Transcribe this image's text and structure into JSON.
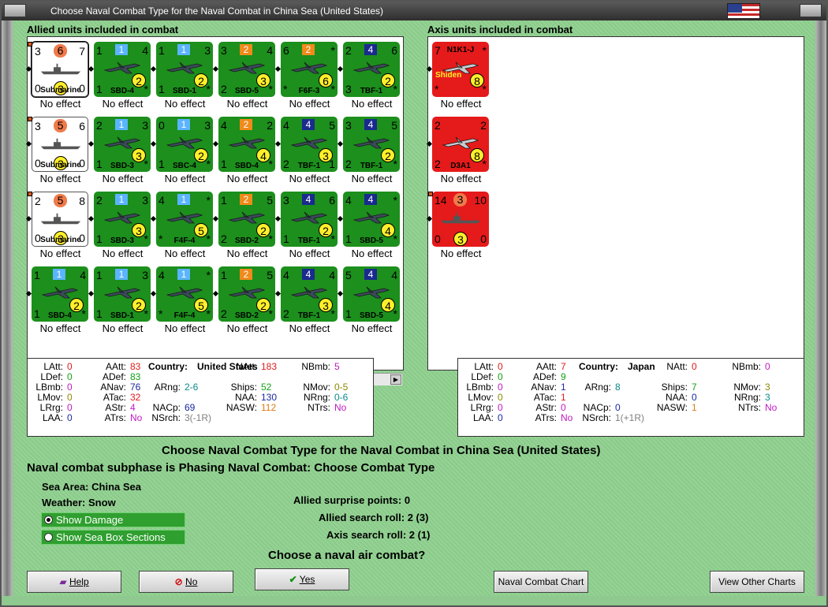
{
  "window": {
    "title": "Choose Naval Combat Type for the Naval Combat in China Sea (United States)"
  },
  "allied": {
    "header": "Allied units included in combat",
    "units": [
      {
        "type": "ship",
        "name": "Submarine",
        "tl": "3",
        "tr": "7",
        "bl": "0",
        "br": "0",
        "top": "6",
        "bottom": "3",
        "effect": "No effect",
        "selected": true
      },
      {
        "type": "air",
        "name": "SBD-4",
        "tl": "1",
        "tr": "4",
        "bl": "1",
        "br": "*",
        "top": "1",
        "topColor": "#5ab4ff",
        "bottom": "2",
        "effect": "No effect"
      },
      {
        "type": "air",
        "name": "SBD-1",
        "tl": "1",
        "tr": "3",
        "bl": "1",
        "br": "*",
        "top": "1",
        "topColor": "#5ab4ff",
        "bottom": "2",
        "effect": "No effect"
      },
      {
        "type": "air",
        "name": "SBD-5",
        "tl": "3",
        "tr": "4",
        "bl": "2",
        "br": "*",
        "top": "2",
        "topColor": "#f08a1a",
        "bottom": "3",
        "effect": "No effect"
      },
      {
        "type": "air",
        "name": "F6F-3",
        "tl": "6",
        "tr": "*",
        "bl": "*",
        "br": "*",
        "top": "2",
        "topColor": "#f08a1a",
        "bottom": "6",
        "effect": "No effect"
      },
      {
        "type": "air",
        "name": "TBF-1",
        "tl": "2",
        "tr": "6",
        "bl": "3",
        "br": "*",
        "top": "4",
        "topColor": "#1a2a8f",
        "bottom": "2",
        "effect": "No effect"
      },
      {
        "type": "ship",
        "name": "Submarine",
        "tl": "3",
        "tr": "6",
        "bl": "0",
        "br": "0",
        "top": "5",
        "bottom": "3",
        "effect": "No effect"
      },
      {
        "type": "air",
        "name": "SBD-3",
        "tl": "2",
        "tr": "3",
        "bl": "1",
        "br": "*",
        "top": "1",
        "topColor": "#5ab4ff",
        "bottom": "3",
        "effect": "No effect"
      },
      {
        "type": "air",
        "name": "SBC-4",
        "tl": "0",
        "tr": "3",
        "bl": "1",
        "br": "*",
        "top": "1",
        "topColor": "#5ab4ff",
        "bottom": "2",
        "effect": "No effect"
      },
      {
        "type": "air",
        "name": "SBD-4",
        "tl": "4",
        "tr": "2",
        "bl": "1",
        "br": "*",
        "top": "2",
        "topColor": "#f08a1a",
        "bottom": "4",
        "effect": "No effect"
      },
      {
        "type": "air",
        "name": "TBF-1",
        "tl": "4",
        "tr": "5",
        "bl": "2",
        "br": "1",
        "top": "4",
        "topColor": "#1a2a8f",
        "bottom": "3",
        "effect": "No effect"
      },
      {
        "type": "air",
        "name": "TBF-1",
        "tl": "3",
        "tr": "5",
        "bl": "2",
        "br": "*",
        "top": "4",
        "topColor": "#1a2a8f",
        "bottom": "2",
        "effect": "No effect"
      },
      {
        "type": "ship",
        "name": "Submarine",
        "tl": "2",
        "tr": "8",
        "bl": "0",
        "br": "0",
        "top": "5",
        "bottom": "3",
        "effect": "No effect"
      },
      {
        "type": "air",
        "name": "SBD-3",
        "tl": "2",
        "tr": "3",
        "bl": "1",
        "br": "*",
        "top": "1",
        "topColor": "#5ab4ff",
        "bottom": "3",
        "effect": "No effect"
      },
      {
        "type": "air",
        "name": "F4F-4",
        "tl": "4",
        "tr": "*",
        "bl": "*",
        "br": "*",
        "top": "1",
        "topColor": "#5ab4ff",
        "bottom": "5",
        "effect": "No effect"
      },
      {
        "type": "air",
        "name": "SBD-2",
        "tl": "1",
        "tr": "5",
        "bl": "2",
        "br": "*",
        "top": "2",
        "topColor": "#f08a1a",
        "bottom": "2",
        "effect": "No effect"
      },
      {
        "type": "air",
        "name": "TBF-1",
        "tl": "3",
        "tr": "6",
        "bl": "1",
        "br": "*",
        "top": "4",
        "topColor": "#1a2a8f",
        "bottom": "2",
        "effect": "No effect"
      },
      {
        "type": "air",
        "name": "SBD-5",
        "tl": "4",
        "tr": "*",
        "bl": "1",
        "br": "*",
        "top": "4",
        "topColor": "#1a2a8f",
        "bottom": "4",
        "effect": "No effect"
      },
      {
        "type": "air",
        "name": "SBD-4",
        "tl": "1",
        "tr": "4",
        "bl": "1",
        "br": "*",
        "top": "1",
        "topColor": "#5ab4ff",
        "bottom": "2",
        "effect": "No effect"
      },
      {
        "type": "air",
        "name": "SBD-1",
        "tl": "1",
        "tr": "3",
        "bl": "1",
        "br": "*",
        "top": "1",
        "topColor": "#5ab4ff",
        "bottom": "2",
        "effect": "No effect"
      },
      {
        "type": "air",
        "name": "F4F-4",
        "tl": "4",
        "tr": "*",
        "bl": "*",
        "br": "*",
        "top": "1",
        "topColor": "#5ab4ff",
        "bottom": "5",
        "effect": "No effect"
      },
      {
        "type": "air",
        "name": "SBD-2",
        "tl": "1",
        "tr": "5",
        "bl": "2",
        "br": "*",
        "top": "2",
        "topColor": "#f08a1a",
        "bottom": "2",
        "effect": "No effect"
      },
      {
        "type": "air",
        "name": "TBF-1",
        "tl": "4",
        "tr": "4",
        "bl": "2",
        "br": "*",
        "top": "4",
        "topColor": "#1a2a8f",
        "bottom": "3",
        "effect": "No effect"
      },
      {
        "type": "air",
        "name": "SBD-5",
        "tl": "5",
        "tr": "4",
        "bl": "1",
        "br": "*",
        "top": "4",
        "topColor": "#1a2a8f",
        "bottom": "4",
        "effect": "No effect"
      }
    ]
  },
  "axis": {
    "header": "Axis units included in combat",
    "units": [
      {
        "type": "air",
        "name": "N1K1-J",
        "tl": "7",
        "tr": "*",
        "bl": "*",
        "br": "*",
        "sub": "Shiden",
        "bottom": "8",
        "effect": "No effect"
      },
      {
        "type": "air",
        "name": "D3A1",
        "tl": "2",
        "tr": "2",
        "bl": "2",
        "br": "*",
        "bottom": "8",
        "effect": "No effect"
      },
      {
        "type": "ship",
        "name": "",
        "tl": "14",
        "tr": "10",
        "bl": "0",
        "br": "0",
        "top": "3",
        "bottom": "3",
        "effect": "No effect"
      }
    ]
  },
  "allied_stats": {
    "country_label": "Country:",
    "country": "United States",
    "LAtt": "0",
    "LDef": "0",
    "LBmb": "0",
    "LMov": "0",
    "LRrg": "0",
    "LAA": "0",
    "AAtt": "83",
    "ADef": "83",
    "ANav": "76",
    "ATac": "32",
    "AStr": "4",
    "ATrs": "No",
    "ARng": "2-6",
    "NACp": "69",
    "NSrch": "3(-1R)",
    "NAtt": "183",
    "Ships": "52",
    "NAA": "130",
    "NASW": "112",
    "NBmb": "5",
    "NMov": "0-5",
    "NRng": "0-6",
    "NTrs": "No"
  },
  "axis_stats": {
    "country_label": "Country:",
    "country": "Japan",
    "LAtt": "0",
    "LDef": "0",
    "LBmb": "0",
    "LMov": "0",
    "LRrg": "0",
    "LAA": "0",
    "AAtt": "7",
    "ADef": "9",
    "ANav": "1",
    "ATac": "1",
    "AStr": "0",
    "ATrs": "No",
    "ARng": "8",
    "NACp": "0",
    "NSrch": "1(+1R)",
    "NAtt": "0",
    "Ships": "7",
    "NAA": "0",
    "NASW": "1",
    "NBmb": "0",
    "NMov": "3",
    "NRng": "3",
    "NTrs": "No"
  },
  "labels": {
    "LAtt": "LAtt:",
    "LDef": "LDef:",
    "LBmb": "LBmb:",
    "LMov": "LMov:",
    "LRrg": "LRrg:",
    "LAA": "LAA:",
    "AAtt": "AAtt:",
    "ADef": "ADef:",
    "ANav": "ANav:",
    "ATac": "ATac:",
    "AStr": "AStr:",
    "ATrs": "ATrs:",
    "ARng": "ARng:",
    "NACp": "NACp:",
    "NSrch": "NSrch:",
    "NAtt": "NAtt:",
    "Ships": "Ships:",
    "NAA": "NAA:",
    "NASW": "NASW:",
    "NBmb": "NBmb:",
    "NMov": "NMov:",
    "NRng": "NRng:",
    "NTrs": "NTrs:"
  },
  "main": {
    "heading": "Choose Naval Combat Type for the Naval Combat in China Sea (United States)",
    "subphase": "Naval combat subphase is Phasing Naval Combat: Choose Combat Type",
    "sea_area_label": "Sea Area:",
    "sea_area": "China Sea",
    "weather_label": "Weather:",
    "weather": "Snow",
    "show_damage": "Show Damage",
    "show_sea_box": "Show Sea Box Sections",
    "surprise": "Allied surprise points:  0",
    "allied_search": "Allied search roll:  2 (3)",
    "axis_search": "Axis search roll:  2 (1)",
    "question": "Choose a naval air combat?"
  },
  "buttons": {
    "help": "Help",
    "no": "No",
    "yes": "Yes",
    "naval_chart": "Naval Combat Chart",
    "other_charts": "View Other Charts"
  },
  "colors": {
    "attack_red": "#e01b1b",
    "defense_green": "#14a014",
    "naval_blue": "#1a2a9f",
    "range_teal": "#0a8a8a",
    "move_olive": "#8a8a00",
    "bomb_magenta": "#c01ac0",
    "asw_orange": "#e07a10",
    "search_gray": "#808080"
  }
}
